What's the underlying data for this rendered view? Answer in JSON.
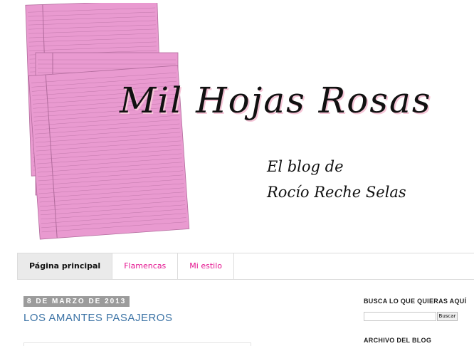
{
  "header": {
    "title": "Mil Hojas Rosas",
    "tagline_line1": "El blog de",
    "tagline_line2": "Rocío Reche Selas",
    "paper_color": "#e99ad0",
    "paper_line_color": "#b16b9c"
  },
  "nav": {
    "tabs": [
      {
        "label": "Página principal"
      },
      {
        "label": "Flamencas"
      },
      {
        "label": "Mi estilo"
      }
    ],
    "active_color": "#eaeaea",
    "link_color": "#e4138f"
  },
  "post": {
    "date": "8 DE MARZO DE 2013",
    "title": "LOS AMANTES PASAJEROS",
    "title_color": "#3d74a6"
  },
  "sidebar": {
    "search_heading": "BUSCA LO QUE QUIERAS AQUÍ",
    "search_value": "",
    "search_button": "Buscar",
    "archive_heading": "ARCHIVO DEL BLOG"
  }
}
